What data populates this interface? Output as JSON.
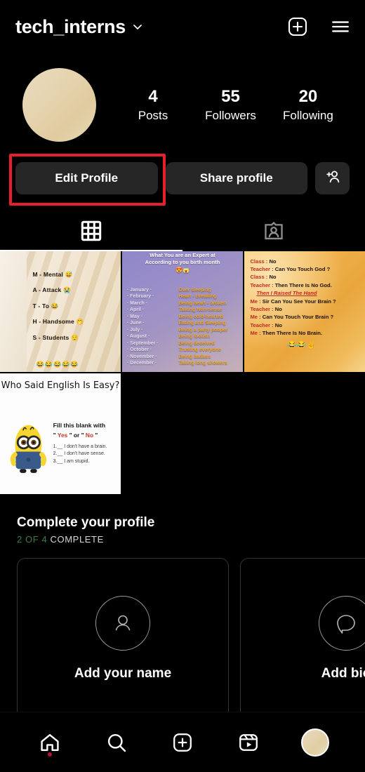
{
  "header": {
    "username": "tech_interns",
    "dropdown_icon": "chevron-down-icon",
    "create_icon": "plus-square-icon",
    "menu_icon": "hamburger-menu-icon"
  },
  "profile": {
    "avatar_alt": "profile-avatar",
    "stats": [
      {
        "value": "4",
        "label": "Posts"
      },
      {
        "value": "55",
        "label": "Followers"
      },
      {
        "value": "20",
        "label": "Following"
      }
    ]
  },
  "actions": {
    "edit_profile": "Edit Profile",
    "share_profile": "Share profile",
    "add_people_icon": "person-add-icon",
    "highlight_color": "#e5202a"
  },
  "tabs": [
    {
      "name": "grid-tab",
      "icon": "grid-icon",
      "active": true
    },
    {
      "name": "tagged-tab",
      "icon": "tagged-person-icon",
      "active": false
    }
  ],
  "posts": [
    {
      "id": "post-maths-acronym",
      "lines": [
        "M - Mental 😅",
        "A - Attack 😭",
        "T - To 😂",
        "H - Handsome 🤭",
        "S - Students 😌"
      ],
      "emojis": "😂😂😂😂😂"
    },
    {
      "id": "post-birth-month",
      "title": "What You are an Expert at",
      "subtitle": "According to you birth month",
      "faces": "😍😱",
      "rows": [
        {
          "month": "· January ·",
          "value": "Over sleeping"
        },
        {
          "month": "· February ·",
          "value": "Heart - Breaking"
        },
        {
          "month": "· March ·",
          "value": "Being heart - broken"
        },
        {
          "month": "· April ·",
          "value": "Talking Non-sense"
        },
        {
          "month": "· May ·",
          "value": "Being cold-hearted"
        },
        {
          "month": "· June ·",
          "value": "Eating and Sleeping"
        },
        {
          "month": "· July ·",
          "value": "Being a party pooper"
        },
        {
          "month": "· August ·",
          "value": "Being foolish"
        },
        {
          "month": "· September ·",
          "value": "Being deceived"
        },
        {
          "month": "· October ·",
          "value": "Trusting everyone"
        },
        {
          "month": "· November ·",
          "value": "Being badass"
        },
        {
          "month": "· December ·",
          "value": "Taking long showers"
        }
      ]
    },
    {
      "id": "post-teacher-joke",
      "lines": [
        {
          "speaker": "Class : ",
          "text": "No"
        },
        {
          "speaker": "Teacher : ",
          "text": "Can You Touch God ?"
        },
        {
          "speaker": "Class : ",
          "text": "No"
        },
        {
          "speaker": "Teacher : ",
          "text": "Then There Is No God."
        }
      ],
      "middle": "Then I Raised The Hand",
      "lines2": [
        {
          "speaker": "Me : ",
          "text": "Sir Can You See Your Brain ?"
        },
        {
          "speaker": "Teacher : ",
          "text": "No"
        },
        {
          "speaker": "Me : ",
          "text": "Can You Touch Your Brain ?"
        },
        {
          "speaker": "Teacher : ",
          "text": "No"
        },
        {
          "speaker": "Me : ",
          "text": "Then There Is No Brain."
        }
      ],
      "emojis": "😂😂✌"
    },
    {
      "id": "post-minion-english",
      "title": "Who Said English Is Easy?",
      "line1": "Fill this blank with",
      "quote_pre": "\" ",
      "quote_yes": "Yes",
      "quote_mid": " \" or \" ",
      "quote_no": "No",
      "quote_post": " \"",
      "items": [
        "1.__ I don't have a brain.",
        "2.__ I don't have sense.",
        "3.__ I am stupid."
      ]
    }
  ],
  "complete_profile": {
    "title": "Complete your profile",
    "progress_green": "2 OF 4",
    "progress_rest": " COMPLETE",
    "cards": [
      {
        "label": "Add your name",
        "icon": "person-outline-icon"
      },
      {
        "label": "Add bio",
        "icon": "speech-bubble-icon"
      }
    ]
  },
  "bottom_nav": [
    {
      "name": "nav-home",
      "icon": "home-icon",
      "badge": true
    },
    {
      "name": "nav-search",
      "icon": "search-icon",
      "badge": false
    },
    {
      "name": "nav-create",
      "icon": "plus-square-icon",
      "badge": false
    },
    {
      "name": "nav-reels",
      "icon": "reels-icon",
      "badge": false
    },
    {
      "name": "nav-profile",
      "icon": "profile-avatar-icon",
      "badge": false
    }
  ]
}
